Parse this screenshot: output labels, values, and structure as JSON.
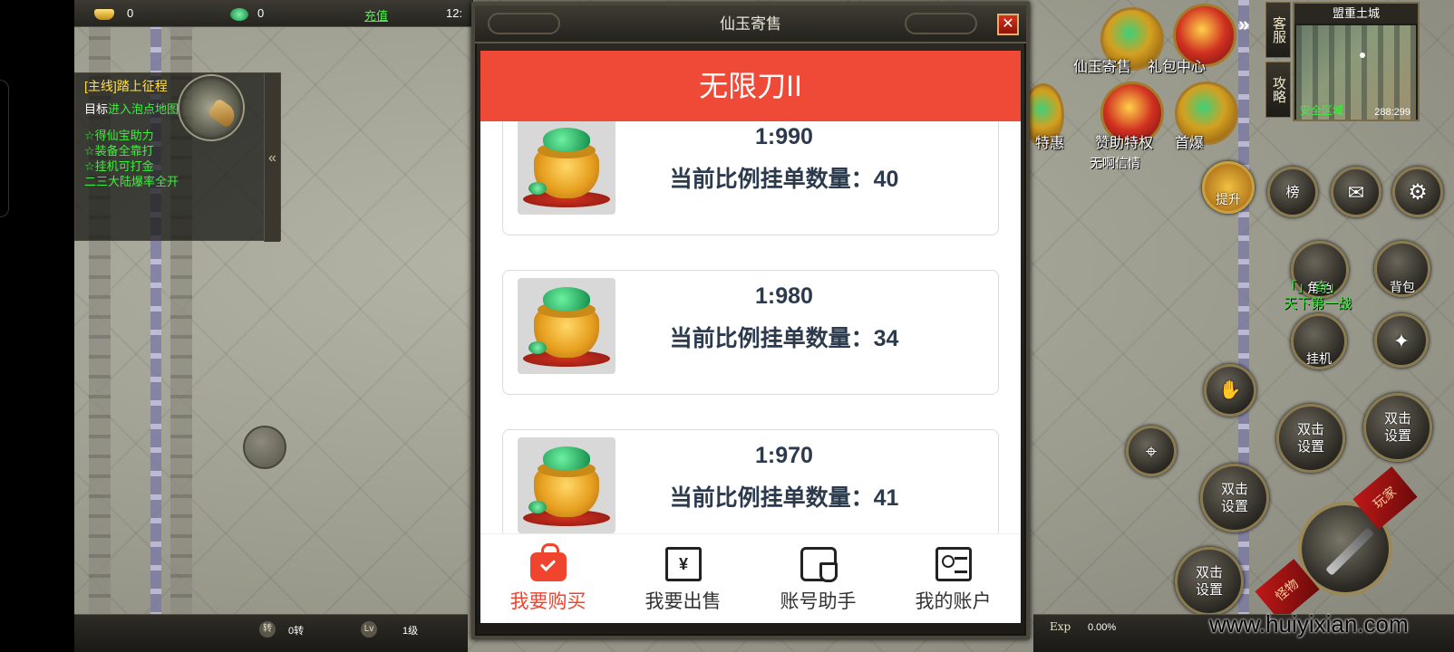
{
  "top_bar": {
    "gold_count": "0",
    "jade_count": "0",
    "recharge_label": "充值",
    "time": "12:"
  },
  "quest": {
    "title": "[主线]踏上征程",
    "target_prefix": "目标",
    "target_link": "进入泡点地图",
    "rewards": [
      "☆得仙宝助力",
      "☆装备全靠打",
      "☆挂机可打金",
      "二三大陆爆率全开"
    ],
    "collapse_glyph": "«"
  },
  "bottom_bar": {
    "zhuan_badge": "转",
    "zhuan_value": "0转",
    "lv_badge": "Lv",
    "lv_value": "1级",
    "exp_label": "Exp",
    "exp_value": "0.00%"
  },
  "watermark": "www.huiyixian.com",
  "modal": {
    "title": "仙玉寄售",
    "close_glyph": "✕",
    "store_title": "无限刀II",
    "listings": [
      {
        "ratio": "1:990",
        "count_label": "当前比例挂单数量：40"
      },
      {
        "ratio": "1:980",
        "count_label": "当前比例挂单数量：34"
      },
      {
        "ratio": "1:970",
        "count_label": "当前比例挂单数量：41"
      }
    ],
    "tabs": [
      {
        "label": "我要购买",
        "icon": "shopping-bag-icon",
        "active": true
      },
      {
        "label": "我要出售",
        "icon": "yuan-box-icon",
        "active": false
      },
      {
        "label": "账号助手",
        "icon": "wallet-shield-icon",
        "active": false
      },
      {
        "label": "我的账户",
        "icon": "id-card-icon",
        "active": false
      }
    ],
    "active_color": "#f0442e",
    "header_color": "#ef4a38"
  },
  "hud": {
    "side_tabs": [
      "客服",
      "攻略"
    ],
    "minimap": {
      "title": "盟重土城",
      "safe_zone": "安全区域",
      "coords": "288:299"
    },
    "feature_labels": {
      "consign": "仙玉寄售",
      "gift_center": "礼包中心",
      "special_offer": "特惠",
      "sponsor": "赞助特权",
      "first_kill": "首爆"
    },
    "npc_name": "无啊信情",
    "upgrade": "提升",
    "rank": "榜",
    "character": "角色",
    "bag": "背包",
    "auto": "挂机",
    "world_first": "天下第一战",
    "world_first_prefix": "「",
    "world_first_mid": "」 奇」",
    "double_click": "双击\n设置",
    "ribbon_1": "玩家",
    "ribbon_2": "怪物"
  }
}
